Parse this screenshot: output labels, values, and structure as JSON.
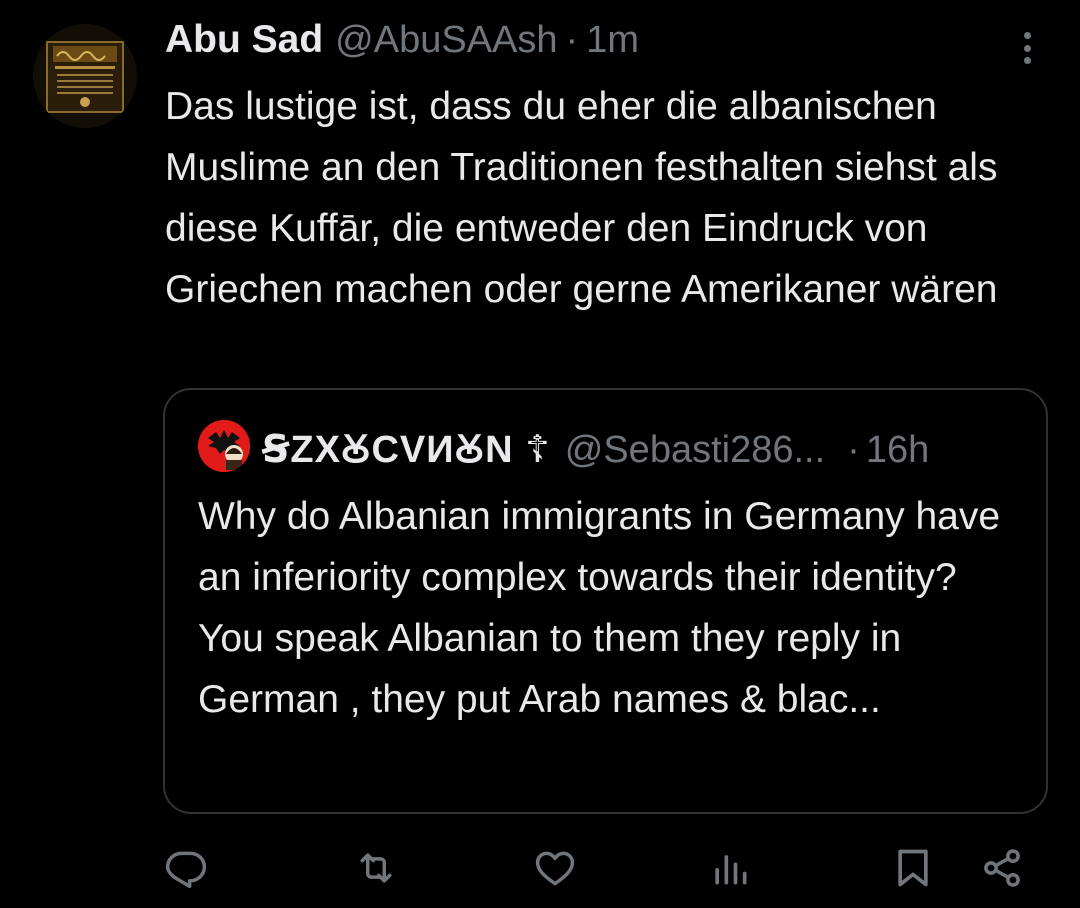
{
  "tweet": {
    "avatar_icon": "framed-calligraphy-avatar",
    "display_name": "Abu Sad",
    "handle": "@AbuSAAsh",
    "separator": "·",
    "time": "1m",
    "text": "Das lustige ist, dass du eher die albanischen Muslime an den Traditionen festhalten siehst als diese Kuffār, die entweder den Eindruck von Griechen machen oder gerne Amerikaner wären"
  },
  "quote": {
    "avatar_icon": "eagle-flag-avatar",
    "display_name": "ꞨZXꙊCVИꙊN ☦",
    "handle": "@Sebasti286...",
    "separator": "·",
    "time": "16h",
    "text": "Why do Albanian immigrants in Germany have an inferiority complex towards their identity? You speak Albanian to them they reply in German , they put Arab names & blac..."
  },
  "actions": {
    "reply_icon": "reply-icon",
    "repost_icon": "repost-icon",
    "like_icon": "heart-icon",
    "views_icon": "analytics-icon",
    "bookmark_icon": "bookmark-icon",
    "share_icon": "share-icon"
  },
  "colors": {
    "background": "#000000",
    "text_primary": "#e7e9ea",
    "text_secondary": "#71767b",
    "border": "#2f3336",
    "quote_avatar_red": "#e11a1a"
  }
}
